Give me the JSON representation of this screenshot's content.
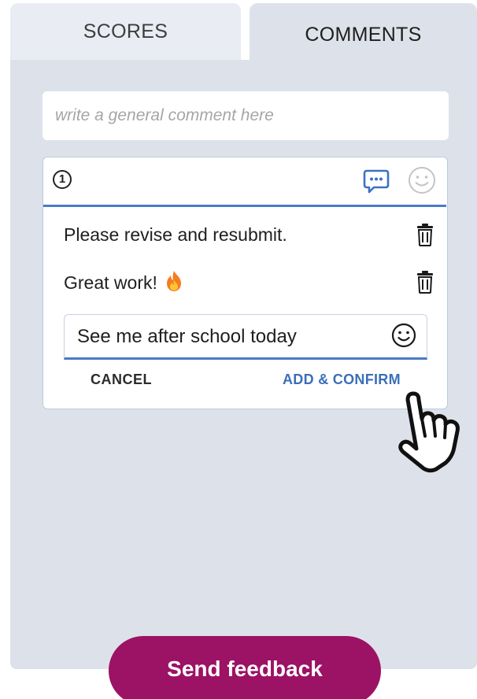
{
  "tabs": [
    {
      "label": "SCORES",
      "active": false
    },
    {
      "label": "COMMENTS",
      "active": true
    }
  ],
  "general_comment": {
    "placeholder": "write a general comment here",
    "value": ""
  },
  "comment_card": {
    "number": "1",
    "header_icons": [
      "comment-bubble-icon",
      "smiley-icon"
    ],
    "comments": [
      {
        "text": "Please revise and resubmit.",
        "emoji": ""
      },
      {
        "text": "Great work!",
        "emoji": "flame-icon"
      }
    ],
    "new_comment": {
      "value": "See me after school today",
      "emoji_button": "smiley-icon"
    },
    "cancel_label": "CANCEL",
    "confirm_label": "ADD & CONFIRM"
  },
  "send_button_label": "Send feedback",
  "colors": {
    "panel_bg": "#dde2ea",
    "tab_inactive_bg": "#e9ecf3",
    "accent_blue": "#4a7bc4",
    "confirm_blue": "#3a6fb8",
    "send_button": "#9c1264"
  }
}
